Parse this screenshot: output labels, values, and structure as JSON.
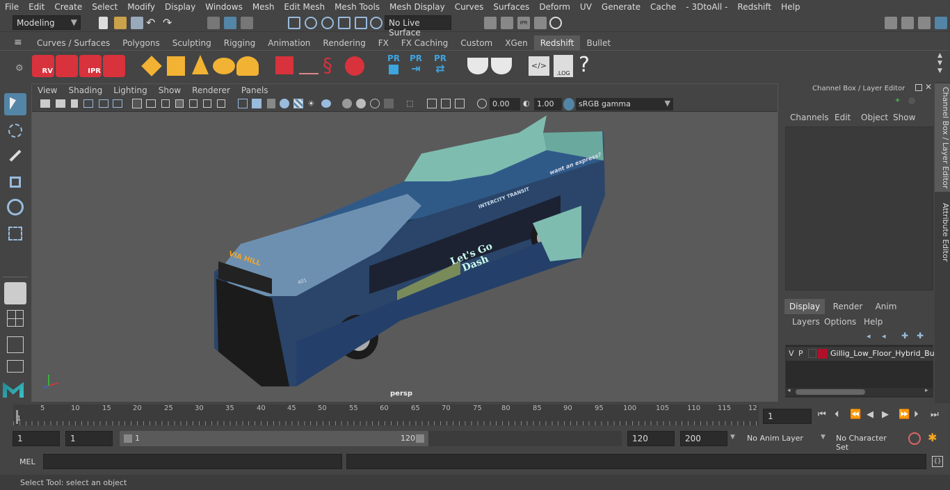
{
  "menu": [
    "File",
    "Edit",
    "Create",
    "Select",
    "Modify",
    "Display",
    "Windows",
    "Mesh",
    "Edit Mesh",
    "Mesh Tools",
    "Mesh Display",
    "Curves",
    "Surfaces",
    "Deform",
    "UV",
    "Generate",
    "Cache",
    "- 3DtoAll -",
    "Redshift",
    "Help"
  ],
  "status_line": {
    "mode": "Modeling",
    "live_surface": "No Live Surface"
  },
  "shelf_tabs": [
    "Curves / Surfaces",
    "Polygons",
    "Sculpting",
    "Rigging",
    "Animation",
    "Rendering",
    "FX",
    "FX Caching",
    "Custom",
    "XGen",
    "Redshift",
    "Bullet"
  ],
  "shelf_active": "Redshift",
  "shelf_icons": {
    "rv": "RV",
    "ipr": "IPR",
    "pr": "PR",
    "log": ".LOG",
    "help": "?"
  },
  "viewport": {
    "menu": [
      "View",
      "Shading",
      "Lighting",
      "Show",
      "Renderer",
      "Panels"
    ],
    "exposure": "0.00",
    "gamma": "1.00",
    "color_space": "sRGB gamma",
    "camera_label": "persp",
    "bus_text": {
      "slogan": "Let's Go Dash",
      "brand": "INTERCITY TRANSIT",
      "tagline": "want an express?",
      "route": "VIA HILL",
      "number": "401"
    }
  },
  "channel_box": {
    "title": "Channel Box / Layer Editor",
    "menu": [
      "Channels",
      "Edit",
      "Object",
      "Show"
    ]
  },
  "layer_editor": {
    "tabs": [
      "Display",
      "Render",
      "Anim"
    ],
    "active_tab": "Display",
    "menu": [
      "Layers",
      "Options",
      "Help"
    ],
    "layer": {
      "v": "V",
      "p": "P",
      "name": "Gillig_Low_Floor_Hybrid_Bus",
      "color": "#b0102a"
    }
  },
  "side_tabs": [
    "Channel Box / Layer Editor",
    "Attribute Editor"
  ],
  "timeline": {
    "ticks": [
      "5",
      "10",
      "15",
      "20",
      "25",
      "30",
      "35",
      "40",
      "45",
      "50",
      "55",
      "60",
      "65",
      "70",
      "75",
      "80",
      "85",
      "90",
      "95",
      "100",
      "105",
      "110",
      "115",
      "12"
    ],
    "start_marker": "1",
    "current_frame": "1"
  },
  "range": {
    "start": "1",
    "playback_start": "1",
    "slider_start": "1",
    "slider_end": "120",
    "playback_end": "120",
    "end": "200",
    "anim_layer": "No Anim Layer",
    "char_set": "No Character Set"
  },
  "command_line": {
    "lang": "MEL"
  },
  "help_line": "Select Tool: select an object",
  "colors": {
    "accent": "#5285a6",
    "selected_tool": "#5285a6",
    "layer_swatch": "#b0102a"
  }
}
